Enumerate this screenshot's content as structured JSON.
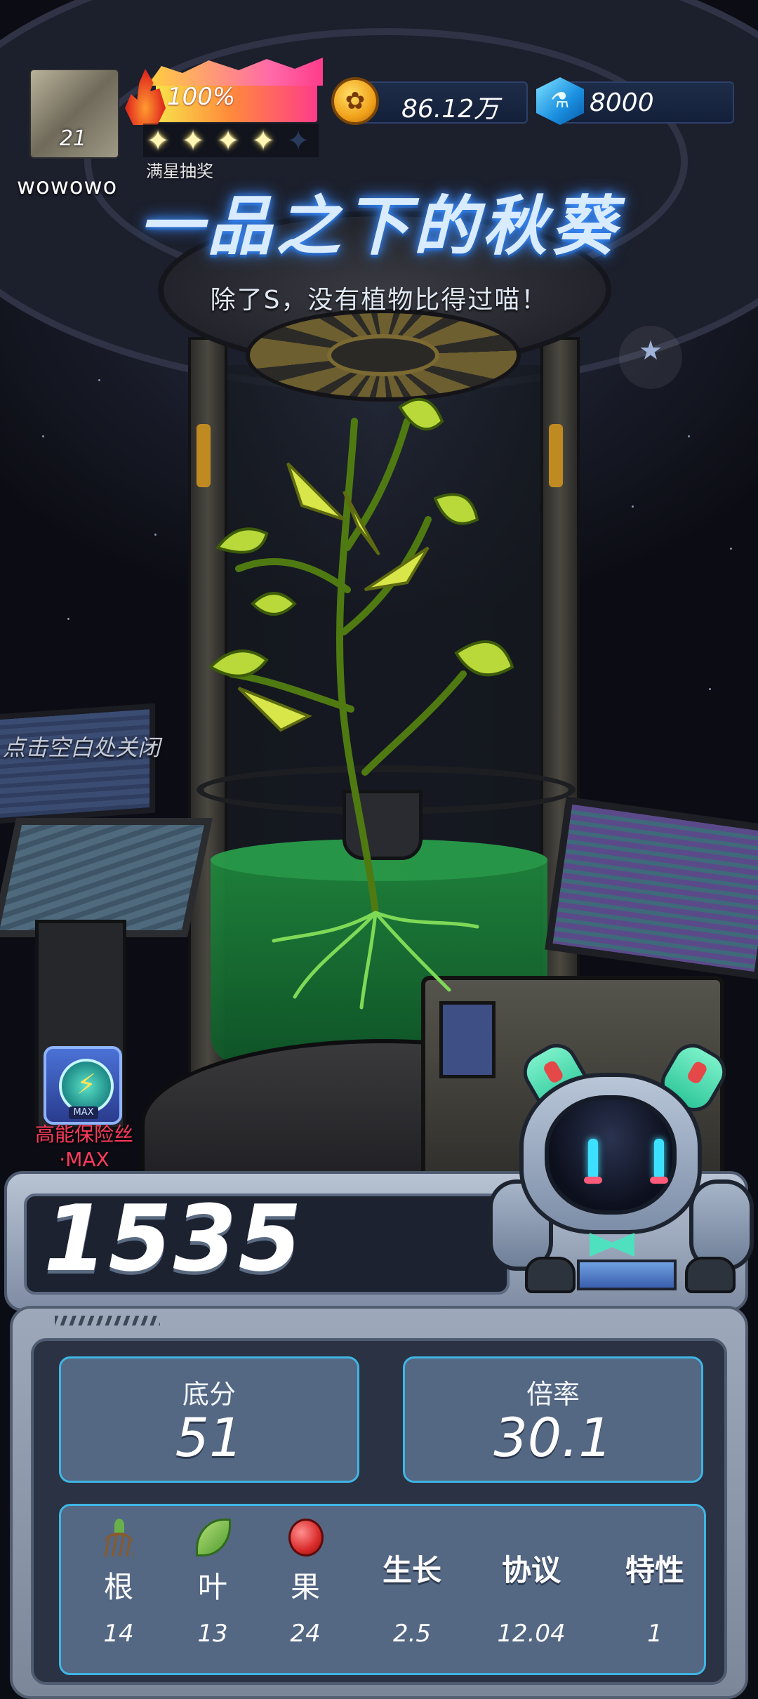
{
  "hud": {
    "player": {
      "name": "wowowo",
      "level": "21"
    },
    "energy": {
      "percent_text": "100%",
      "level": 1.0
    },
    "stars": {
      "filled": 4,
      "total": 5,
      "label": "满星抽奖"
    },
    "currencies": {
      "coins": {
        "value": "86.12万",
        "icon": "coin-icon"
      },
      "gems": {
        "value": "8000",
        "icon": "gem-icon"
      }
    }
  },
  "plant": {
    "name": "一品之下的秋葵",
    "tagline": "除了S，没有植物比得过喵！"
  },
  "hint": {
    "close": "点击空白处关闭"
  },
  "buff": {
    "label_line1": "高能保险丝",
    "label_line2": "·MAX",
    "badge": "MAX",
    "icon": "fuse-icon"
  },
  "result": {
    "total_score": "1535",
    "base_score": {
      "label": "底分",
      "value": "51"
    },
    "multiplier": {
      "label": "倍率",
      "value": "30.1"
    },
    "attributes": [
      {
        "name": "根",
        "value": "14",
        "icon": "root-icon"
      },
      {
        "name": "叶",
        "value": "13",
        "icon": "leaf-icon"
      },
      {
        "name": "果",
        "value": "24",
        "icon": "apple-icon"
      },
      {
        "name": "生长",
        "value": "2.5"
      },
      {
        "name": "协议",
        "value": "12.04"
      },
      {
        "name": "特性",
        "value": "1"
      }
    ]
  },
  "colors": {
    "accent_cyan": "#3fb5e4",
    "card_bg": "#546783",
    "title_glow": "#3a8cff",
    "buff_label": "#ff3a5c",
    "energy_gradient": [
      "#f7e34b",
      "#ff8c3a",
      "#ff3c8a"
    ]
  }
}
